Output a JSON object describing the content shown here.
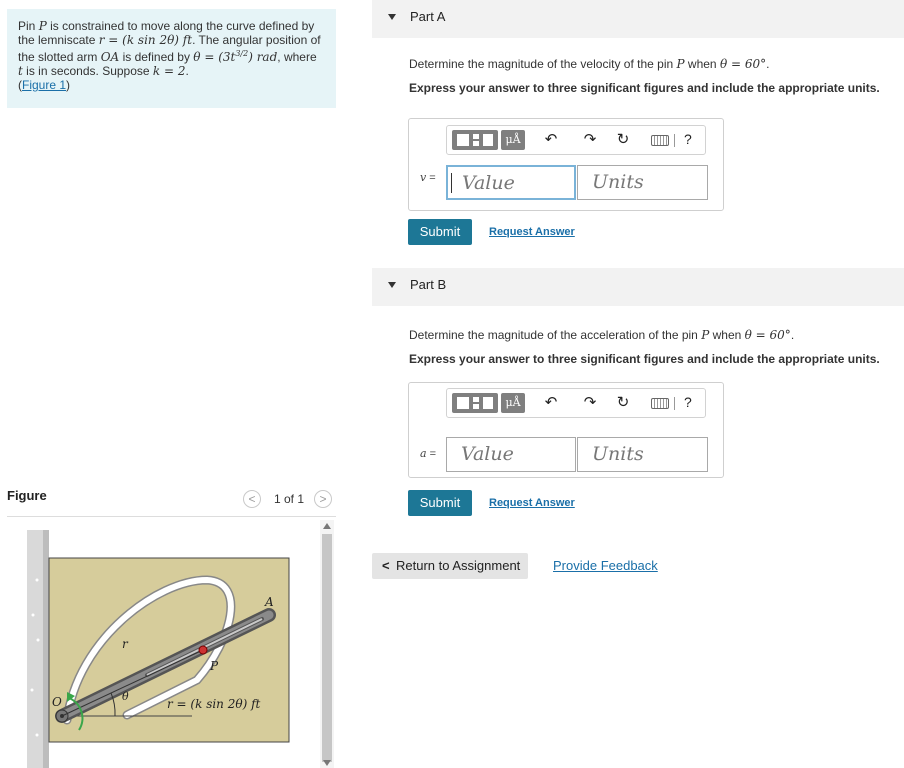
{
  "problem": {
    "line1_a": "Pin ",
    "line1_P": "P",
    "line1_b": " is constrained to move along the curve defined by",
    "line2_a": "the lemniscate ",
    "line2_eq": "r = (k sin 2θ) ft",
    "line2_b": ". The angular position of",
    "line3_a": "the slotted arm ",
    "line3_OA": "OA",
    "line3_b": " is defined by ",
    "line3_eq": "θ = (3t",
    "line3_exp": "3/2",
    "line3_eq2": ") rad",
    "line3_c": ", where",
    "line4_t": "t",
    "line4_a": " is in seconds. Suppose ",
    "line4_eq": "k = 2",
    "line4_b": ".",
    "figure_link": "Figure 1"
  },
  "figure": {
    "title": "Figure",
    "counter": "1 of 1",
    "prev": "<",
    "next": ">",
    "labels": {
      "O": "O",
      "A": "A",
      "P": "P",
      "r": "r",
      "theta": "θ",
      "equation": "r = (k sin 2θ) ft"
    }
  },
  "partA": {
    "header": "Part A",
    "question_a": "Determine the magnitude of the velocity of the pin ",
    "question_P": "P",
    "question_b": " when ",
    "question_eq": "θ = 60°",
    "question_c": ".",
    "instruction": "Express your answer to three significant figures and include the appropriate units.",
    "var_label": "v",
    "equals": " =",
    "value_placeholder": "Value",
    "units_placeholder": "Units",
    "submit": "Submit",
    "request": "Request Answer"
  },
  "partB": {
    "header": "Part B",
    "question_a": "Determine the magnitude of the acceleration of the pin ",
    "question_P": "P",
    "question_b": " when ",
    "question_eq": "θ = 60°",
    "question_c": ".",
    "instruction": "Express your answer to three significant figures and include the appropriate units.",
    "var_label": "a",
    "equals": " =",
    "value_placeholder": "Value",
    "units_placeholder": "Units",
    "submit": "Submit",
    "request": "Request Answer"
  },
  "toolbar": {
    "units_label": "μÅ",
    "undo": "↶",
    "redo": "↷",
    "reset": "↻",
    "help": "?"
  },
  "footer": {
    "return_chevron": "<",
    "return_label": "Return to Assignment",
    "feedback": "Provide Feedback"
  }
}
